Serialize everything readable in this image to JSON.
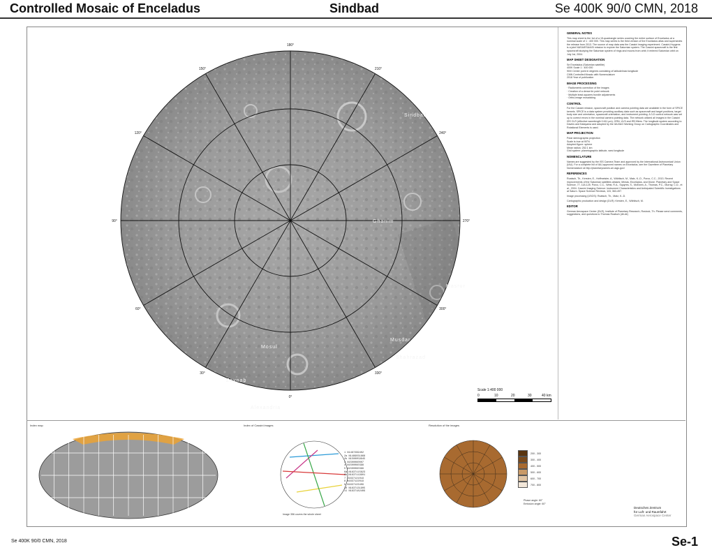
{
  "header": {
    "left_title": "Controlled Mosaic of Enceladus",
    "center_title": "Sindbad",
    "right_title": "Se 400K 90/0 CMN, 2018"
  },
  "map": {
    "longitude_labels": [
      "180°",
      "150°",
      "210°",
      "120°",
      "240°",
      "90°",
      "270°",
      "60°",
      "300°",
      "30°",
      "330°",
      "0°"
    ],
    "feature_names": [
      "Sindbad",
      "Ghanim",
      "Masrur",
      "Mosul",
      "Zaynab",
      "Shahrazad",
      "Musdar",
      "Alexandria"
    ],
    "ring_color": "#111111",
    "surface_color": "#9a9a9a"
  },
  "notes": {
    "general_title": "GENERAL NOTES",
    "general_text": "This map sheet is the 1st of a 15-quadrangle series covering the entire surface of Enceladus at a nominal scale of 1 : 400 000. This map series is the third version of the Enceladus atlas and supersedes the release from 2013. The source of map data was the Cassini imaging experiment. Cassini-Huygens is a joint NASA/ESA/ASI mission to explore the Saturnian system. The Cassini spacecraft is the first spacecraft studying the Saturnian system of rings and moons from orbit; it entered Saturnian orbit on July 1st, 2004.",
    "designation_title": "MAP SHEET DESIGNATION",
    "designation_lines": [
      "Se      Enceladus (Saturnian satellite)",
      "400K    Scale 1 : 400 000",
      "90/0    Center point in degrees consisting of latitude/east longitude",
      "CMN     Controlled Mosaic with Nomenclature",
      "2018    Year of publication"
    ],
    "processing_title": "IMAGE PROCESSING",
    "processing_lines": [
      "· Radiometric correction of the images",
      "· Creation of a dense tie point network",
      "· Multiple least-squares bundle adjustments",
      "· Ortho-image mosaicking"
    ],
    "control_title": "CONTROL",
    "control_text": "For the Cassini mission, spacecraft position and camera pointing data are available in the form of SPICE kernels. SPICE is a data system providing auxiliary data such as spacecraft and target positions, target body size and orientation, spacecraft orientation, and instrument pointing. A 3-D control network was set up to correct errors in the nominal camera pointing data. The network utilized all images in the Cassini ISS CLR (effective wavelength 0.611 µm), GRN, UV3 and IR3 filters. The longitude system according to Davies and Katayama and adopted by the IAU/IAG Working Group on Cartographic Coordinates and Rotational Elements is used.",
    "projection_title": "MAP PROJECTION",
    "projection_lines": [
      "Polar stereographic projection",
      "Scale is true at 90°N",
      "Adopted figure: sphere",
      "Mean radius: 252.1 km",
      "Grid system: planetographic latitude, west longitude"
    ],
    "nomenclature_title": "NOMENCLATURE",
    "nomenclature_text": "Names are suggested by the ISS Camera Team and approved by the International Astronomical Union (IAU). For a complete list of IAU-approved names on Enceladus, see the Gazetteer of Planetary Nomenclature at http://planetarynames.wr.usgs.gov/",
    "references_title": "REFERENCES",
    "references_text": "Roatsch, Th., Kersten, E., Hoffmeister, A., Wählisch, M., Matz, K.-D., Porco, C.C., 2013. Recent improvements of the Saturnian satellites atlases: Mimas, Enceladus, and Dione. Planetary and Space Science, 77, 118-125. Porco, C.C., West, R.A., Squyres, S., McEwen, A., Thomas, P.C., Murray, C.D., et al., 2004. Cassini Imaging Science: Instrument Characteristics and Anticipated Scientific Investigations at Saturn. Space Science Reviews, 115, 363-497.",
    "processing_credit": "Image processing (USGS): Roatsch, Th., Matz, K.-D.",
    "carto_credit": "Cartographic production and design (DLR): Kersten, E., Wählisch, M.",
    "editor_title": "EDITOR",
    "editor_text": "German Aerospace Center (DLR), Institute of Planetary Research, Rostock, Th. Please send comments, suggestions, and questions to Thomas Roatsch (dlr.de)"
  },
  "scale": {
    "title": "Scale 1:400 000",
    "ticks": [
      "0",
      "10",
      "20",
      "30",
      "40 km"
    ]
  },
  "panels": {
    "index_title": "Index map",
    "image_index_title": "Index of Cassini images",
    "resolution_title": "Resolution of the images",
    "image_list": [
      "1  N1487299402",
      "2a N1489031868",
      "2b N1500059945",
      "3  N1500060007",
      "4  N1500060398",
      "5  N1500060399",
      "6a N1637115823",
      "6b N1637119901",
      "7  N1637121019",
      "8  N1637122019",
      "9  N1637123409",
      "10 N1637131905",
      "11 N1637182409"
    ],
    "image_note": "Image 356 covers the whole sheet",
    "resolution_legend": [
      "200 - 300",
      "300 - 400",
      "400 - 500",
      "500 - 600",
      "600 - 700",
      "700 - 800"
    ],
    "phase_note": "Phase angle: 60°",
    "resolution_note": "Emission angle: 60°"
  },
  "logo": {
    "line1": "Deutsches Zentrum",
    "line2": "für Luft- und Raumfahrt",
    "line3": "German Aerospace Center"
  },
  "footer": {
    "left": "Se 400K 90/0 CMN, 2018",
    "right": "Se-1"
  }
}
